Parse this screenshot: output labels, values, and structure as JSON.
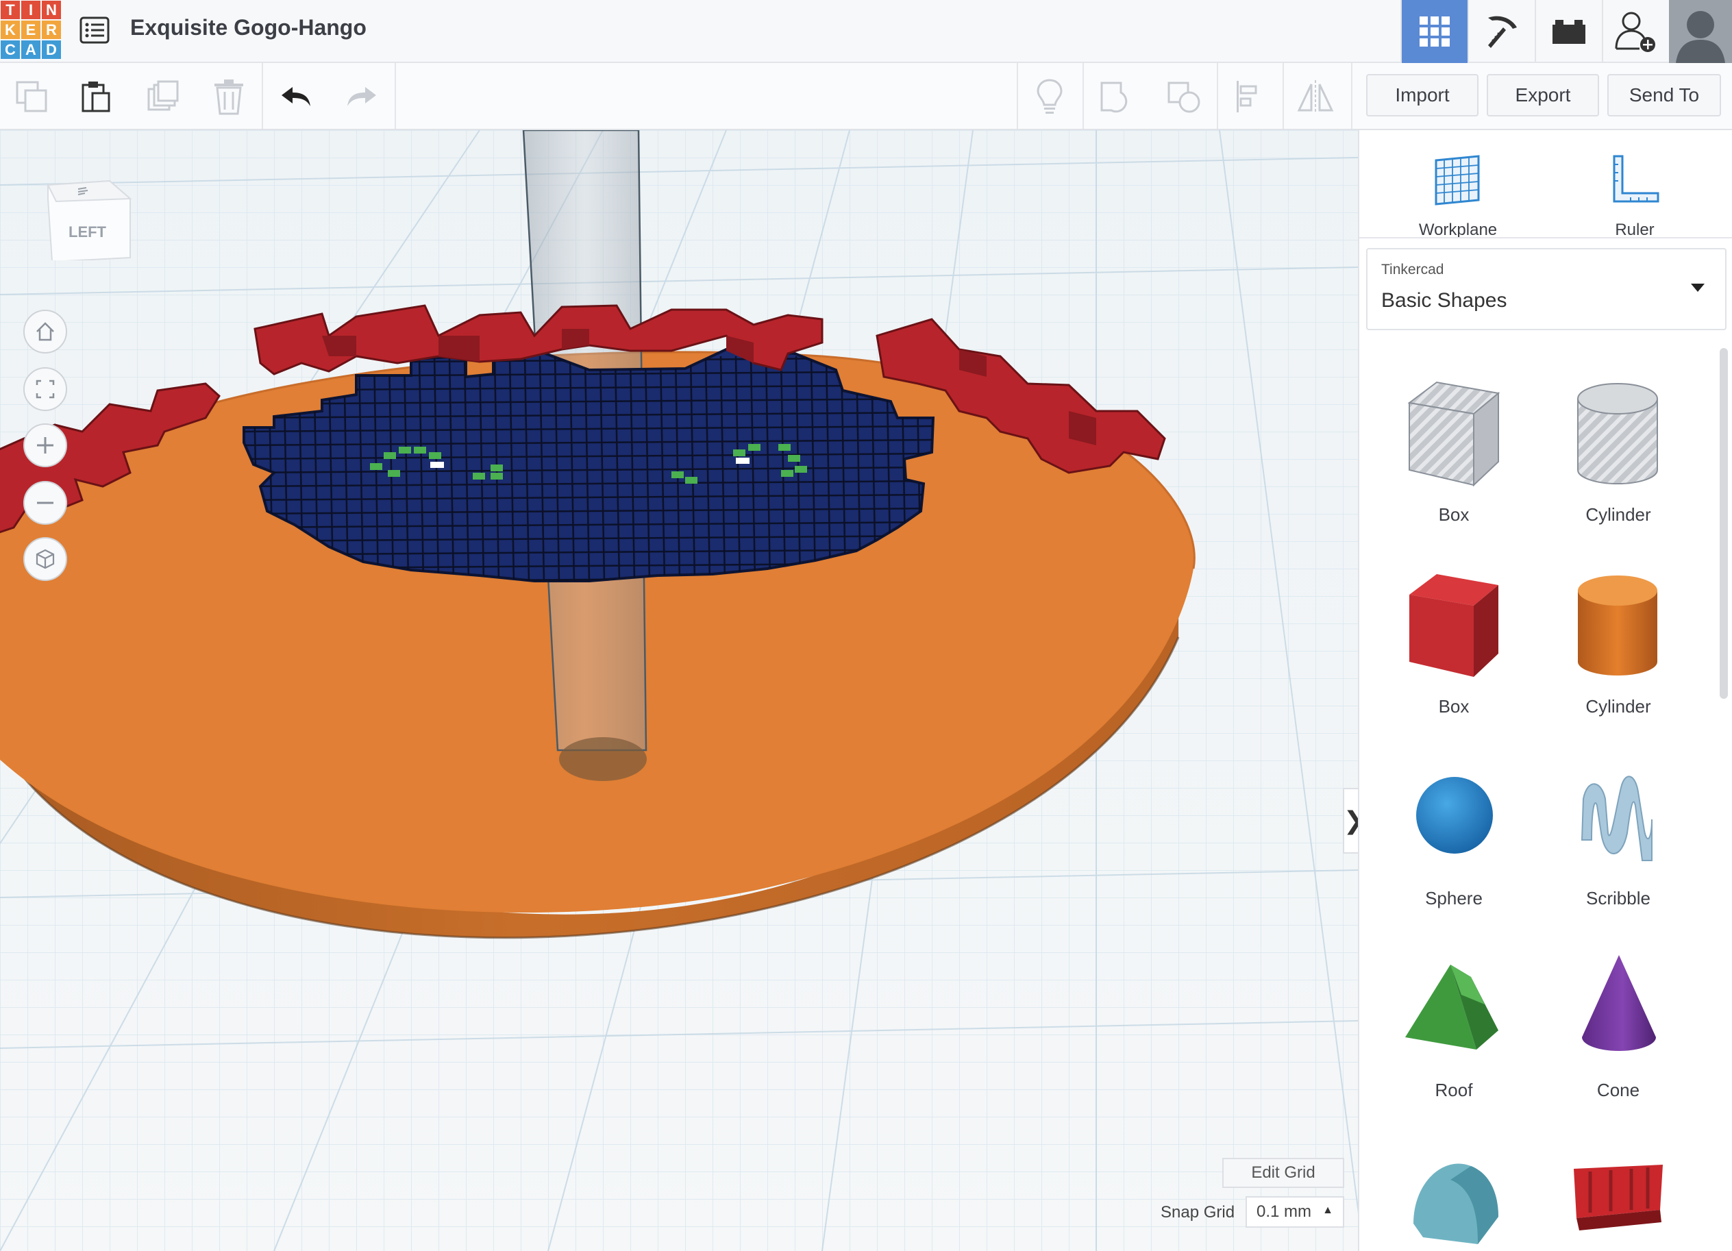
{
  "header": {
    "logo_letters": [
      "T",
      "I",
      "N",
      "K",
      "E",
      "R",
      "C",
      "A",
      "D"
    ],
    "logo_colors": [
      "#e04d39",
      "#e04d39",
      "#e04d39",
      "#f2a53c",
      "#f2a53c",
      "#f2a53c",
      "#3f9bd5",
      "#3f9bd5",
      "#3f9bd5"
    ],
    "title": "Exquisite Gogo-Hango",
    "nav_icons": [
      "grid-view-icon",
      "pickaxe-icon",
      "bricks-icon",
      "add-user-icon"
    ],
    "accent": "#5a8ad4"
  },
  "toolbar": {
    "import_label": "Import",
    "export_label": "Export",
    "send_label": "Send To"
  },
  "viewport": {
    "viewcube_label": "LEFT",
    "edit_grid_label": "Edit Grid",
    "snap_grid_label": "Snap Grid",
    "snap_grid_value": "0.1 mm",
    "base_color": "#e07f35",
    "text_color": "#b8242b",
    "pixel_color": "#182a6e"
  },
  "panel": {
    "workplane_label": "Workplane",
    "ruler_label": "Ruler",
    "library_source": "Tinkercad",
    "library_name": "Basic Shapes",
    "shapes": [
      {
        "label": "Box"
      },
      {
        "label": "Cylinder"
      },
      {
        "label": "Box"
      },
      {
        "label": "Cylinder"
      },
      {
        "label": "Sphere"
      },
      {
        "label": "Scribble"
      },
      {
        "label": "Roof"
      },
      {
        "label": "Cone"
      },
      {
        "label": ""
      },
      {
        "label": ""
      }
    ]
  }
}
